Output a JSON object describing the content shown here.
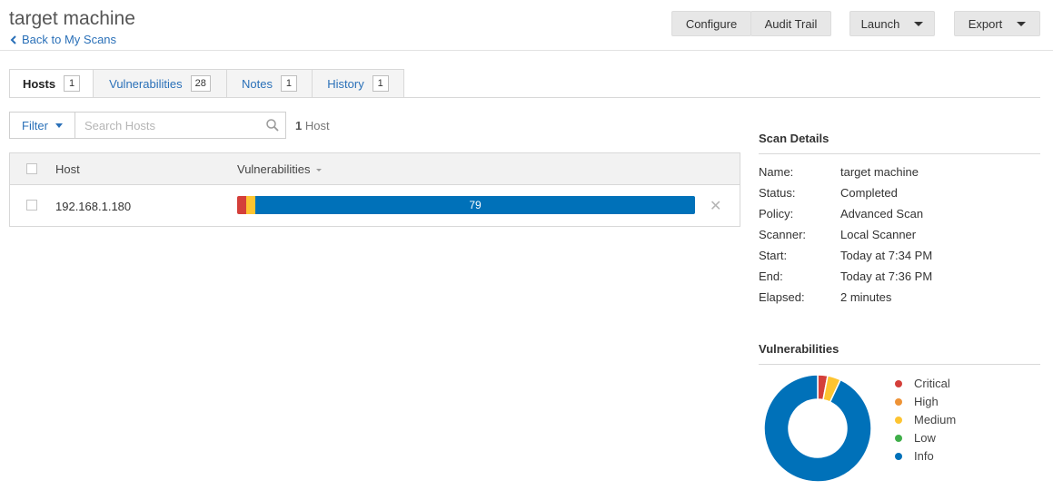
{
  "header": {
    "title": "target machine",
    "back_label": "Back to My Scans",
    "buttons": {
      "configure": "Configure",
      "audit_trail": "Audit Trail",
      "launch": "Launch",
      "export": "Export"
    }
  },
  "tabs": [
    {
      "label": "Hosts",
      "count": "1",
      "active": true
    },
    {
      "label": "Vulnerabilities",
      "count": "28",
      "active": false
    },
    {
      "label": "Notes",
      "count": "1",
      "active": false
    },
    {
      "label": "History",
      "count": "1",
      "active": false
    }
  ],
  "filter": {
    "label": "Filter",
    "search_placeholder": "Search Hosts",
    "count_number": "1",
    "count_text": " Host"
  },
  "table": {
    "columns": {
      "host": "Host",
      "vulnerabilities": "Vulnerabilities"
    },
    "rows": [
      {
        "host": "192.168.1.180",
        "critical_fraction": 0.02,
        "medium_fraction": 0.02,
        "info_count": "79"
      }
    ]
  },
  "scan_details": {
    "title": "Scan Details",
    "fields": [
      {
        "label": "Name:",
        "value": "target machine"
      },
      {
        "label": "Status:",
        "value": "Completed"
      },
      {
        "label": "Policy:",
        "value": "Advanced Scan"
      },
      {
        "label": "Scanner:",
        "value": "Local Scanner"
      },
      {
        "label": "Start:",
        "value": "Today at 7:34 PM"
      },
      {
        "label": "End:",
        "value": "Today at 7:36 PM"
      },
      {
        "label": "Elapsed:",
        "value": "2 minutes"
      }
    ]
  },
  "vulnerabilities_panel": {
    "title": "Vulnerabilities",
    "legend": [
      {
        "label": "Critical",
        "color": "#d43f3a"
      },
      {
        "label": "High",
        "color": "#ee9336"
      },
      {
        "label": "Medium",
        "color": "#fdc431"
      },
      {
        "label": "Low",
        "color": "#3fae49"
      },
      {
        "label": "Info",
        "color": "#0071b9"
      }
    ],
    "donut_fractions": {
      "critical": 0.03,
      "high": 0.0,
      "medium": 0.04,
      "low": 0.0,
      "info": 0.93
    }
  },
  "colors": {
    "accent": "#2a70b8",
    "critical": "#d43f3a",
    "medium": "#fdc431",
    "info": "#0071b9"
  }
}
